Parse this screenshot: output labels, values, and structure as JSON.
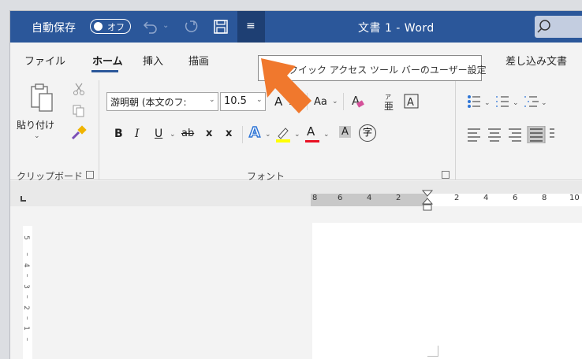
{
  "titlebar": {
    "autosave_label": "自動保存",
    "autosave_state": "オフ",
    "doc_title": "文書 1  -  Word",
    "qat_icon": "customize-qat-icon"
  },
  "tabs": {
    "file": "ファイル",
    "home": "ホーム",
    "insert": "挿入",
    "draw": "描画",
    "mailings": "差し込み文書"
  },
  "tooltip": {
    "text": "クイック アクセス ツール バーのユーザー設定"
  },
  "ribbon": {
    "paste_label": "貼り付け",
    "clipboard_group": "クリップボード",
    "font_group": "フォント",
    "font_name": "游明朝 (本文のフ:",
    "font_size": "10.5",
    "change_case": "Aa",
    "bold": "B",
    "italic": "I",
    "underline": "U",
    "strikethrough": "ab",
    "subscript": "x",
    "superscript": "x",
    "grow_font": "A",
    "shrink_font": "A",
    "text_effects": "A",
    "font_color": "A",
    "char_shading": "A",
    "enclose_char": "字"
  },
  "ruler": {
    "numbers_left": [
      "8",
      "6",
      "4",
      "2"
    ],
    "numbers_right": [
      "2",
      "4",
      "6",
      "8",
      "10"
    ],
    "vertical_numbers": [
      "5",
      "4",
      "3",
      "2",
      "1"
    ]
  },
  "colors": {
    "titlebar": "#2b579a",
    "accent_arrow": "#f0782d",
    "highlight_yellow": "#ffff00",
    "font_red": "#e81123"
  }
}
